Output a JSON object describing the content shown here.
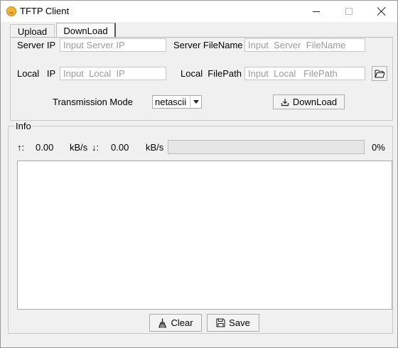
{
  "window": {
    "title": "TFTP Client",
    "icon": "app-icon"
  },
  "tabs": [
    {
      "label": "Upload",
      "selected": false
    },
    {
      "label": "DownLoad",
      "selected": true
    }
  ],
  "download_panel": {
    "server_ip_label": "Server IP",
    "server_ip_placeholder": "Input Server IP",
    "server_filename_label": "Server FileName",
    "server_filename_placeholder": "Input  Server  FileName",
    "local_ip_label": "Local   IP",
    "local_ip_placeholder": "Input  Local  IP",
    "local_filepath_label": "Local  FilePath",
    "local_filepath_placeholder": "Input  Local   FilePath",
    "browse_icon": "folder-open-icon",
    "transmission_mode_label": "Transmission Mode",
    "transmission_mode_value": "netascii",
    "download_button_label": "DownLoad",
    "download_button_icon": "download-icon"
  },
  "info": {
    "group_label": "Info",
    "upload_arrow": "↑:",
    "upload_speed": "0.00",
    "upload_unit": "kB/s",
    "download_arrow": "↓:",
    "download_speed": "0.00",
    "download_unit": "kB/s",
    "progress_text": "0%",
    "progress_value": 0,
    "log_text": ""
  },
  "buttons": {
    "clear_label": "Clear",
    "clear_icon": "broom-icon",
    "save_label": "Save",
    "save_icon": "floppy-disk-icon"
  },
  "colors": {
    "progress_fill": "#06b025",
    "window_bg": "#f0f0f0"
  }
}
